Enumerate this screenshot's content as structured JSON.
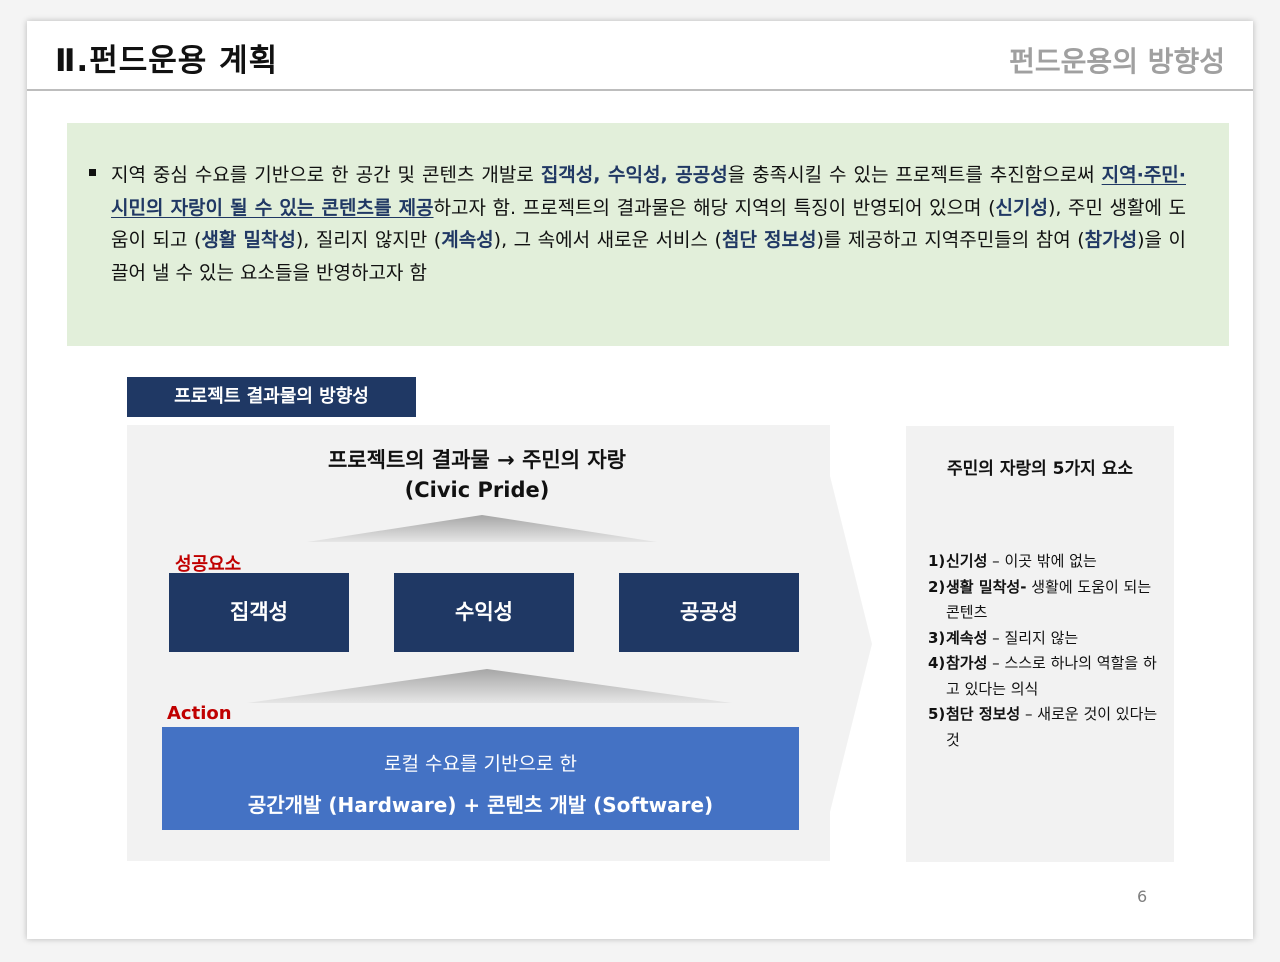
{
  "header": {
    "title": "Ⅱ.펀드운용 계획",
    "subtitle": "펀드운용의 방향성"
  },
  "intro": {
    "seg1": "지역 중심 수요를 기반으로 한 공간 및 콘텐츠 개발로 ",
    "hl1": "집객성, 수익성, 공공성",
    "seg2": "을 충족시킬 수 있는 프로젝트를 추진함으로써 ",
    "hl2": "지역·주민·시민의 자랑이 될 수 있는 콘텐츠를 제공",
    "seg3": "하고자 함. 프로젝트의 결과물은 해당 지역의 특징이 반영되어 있으며 (",
    "hl3": "신기성",
    "seg4": "), 주민 생활에 도움이 되고 (",
    "hl4": "생활 밀착성",
    "seg5": "), 질리지 않지만 (",
    "hl5": "계속성",
    "seg6": "), 그 속에서 새로운 서비스 (",
    "hl6": "첨단 정보성",
    "seg7": ")를 제공하고 지역주민들의 참여 (",
    "hl7": "참가성",
    "seg8": ")을 이끌어 낼 수 있는 요소들을 반영하고자 함"
  },
  "diagram": {
    "tag": "프로젝트 결과물의 방향성",
    "title_line1": "프로젝트의 결과물 → 주민의 자랑",
    "title_line2": "(Civic Pride)",
    "success_label": "성공요소",
    "factors": [
      "집객성",
      "수익성",
      "공공성"
    ],
    "action_label": "Action",
    "action_line1": "로컬 수요를 기반으로 한",
    "action_line2": "공간개발 (Hardware) + 콘텐츠 개발 (Software)"
  },
  "elements": {
    "title": "주민의 자랑의 5가지 요소",
    "items": [
      {
        "num": "1)",
        "term": "신기성",
        "desc": " – 이곳 밖에 없는"
      },
      {
        "num": "2)",
        "term": "생활 밀착성-",
        "desc": " 생활에 도움이 되는 콘텐츠"
      },
      {
        "num": "3)",
        "term": "계속성",
        "desc": " – 질리지 않는"
      },
      {
        "num": "4)",
        "term": "참가성",
        "desc": " – 스스로 하나의 역할을 하고 있다는 의식"
      },
      {
        "num": "5)",
        "term": "첨단 정보성",
        "desc": " – 새로운 것이 있다는 것"
      }
    ]
  },
  "page_number": "6",
  "colors": {
    "navy": "#1f3864",
    "blue": "#4472c4",
    "red_label": "#c00000",
    "intro_bg": "#e2efda",
    "panel_bg": "#f2f2f2"
  }
}
